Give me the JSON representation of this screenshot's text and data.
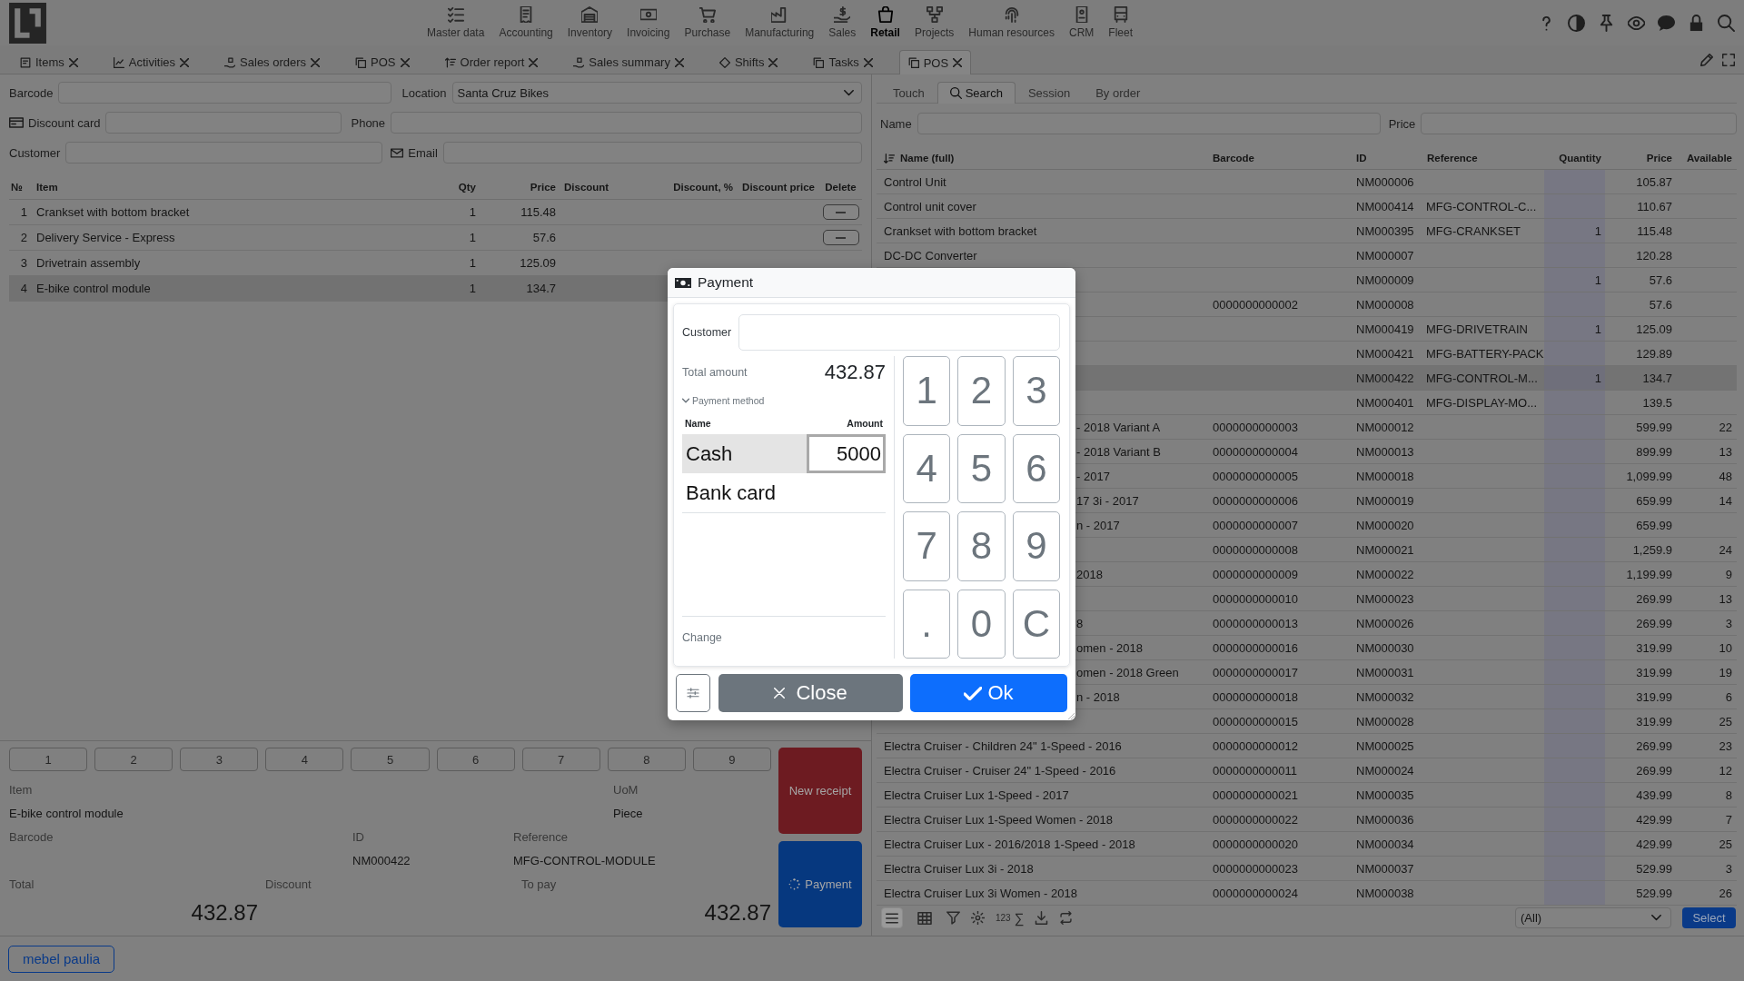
{
  "top_bar": {
    "modules": [
      {
        "label": "Master data",
        "selected": false
      },
      {
        "label": "Accounting",
        "selected": false
      },
      {
        "label": "Inventory",
        "selected": false
      },
      {
        "label": "Invoicing",
        "selected": false
      },
      {
        "label": "Purchase",
        "selected": false
      },
      {
        "label": "Manufacturing",
        "selected": false
      },
      {
        "label": "Sales",
        "selected": false
      },
      {
        "label": "Retail",
        "selected": true
      },
      {
        "label": "Projects",
        "selected": false
      },
      {
        "label": "Human resources",
        "selected": false
      },
      {
        "label": "CRM",
        "selected": false
      },
      {
        "label": "Fleet",
        "selected": false
      }
    ]
  },
  "tabs": [
    {
      "label": "Items",
      "selected": false
    },
    {
      "label": "Activities",
      "selected": false
    },
    {
      "label": "Sales orders",
      "selected": false
    },
    {
      "label": "POS",
      "selected": false
    },
    {
      "label": "Order report",
      "selected": false
    },
    {
      "label": "Sales summary",
      "selected": false
    },
    {
      "label": "Shifts",
      "selected": false
    },
    {
      "label": "Tasks",
      "selected": false
    },
    {
      "label": "POS",
      "selected": true
    }
  ],
  "pos": {
    "barcode_label": "Barcode",
    "location_label": "Location",
    "location": "Santa Cruz Bikes",
    "discount_card_label": "Discount card",
    "phone_label": "Phone",
    "customer_label": "Customer",
    "email_label": "Email",
    "receipt": {
      "columns": [
        "№",
        "Item",
        "Qty",
        "Price",
        "Discount",
        "Discount, %",
        "Discount price",
        "Delete"
      ],
      "rows": [
        {
          "n": "1",
          "item": "Crankset with bottom bracket",
          "qty": "1",
          "price": "115.48",
          "delete_button": true,
          "selected": false
        },
        {
          "n": "2",
          "item": "Delivery Service - Express",
          "qty": "1",
          "price": "57.6",
          "delete_button": true,
          "selected": false
        },
        {
          "n": "3",
          "item": "Drivetrain assembly",
          "qty": "1",
          "price": "125.09",
          "delete_button": false,
          "selected": false
        },
        {
          "n": "4",
          "item": "E-bike control module",
          "qty": "1",
          "price": "134.7",
          "delete_button": false,
          "selected": true
        }
      ]
    },
    "quick_keys": [
      "1",
      "2",
      "3",
      "4",
      "5",
      "6",
      "7",
      "8",
      "9"
    ],
    "details": {
      "item_label": "Item",
      "item": "E-bike control module",
      "uom_label": "UoM",
      "uom": "Piece",
      "barcode_label": "Barcode",
      "id_label": "ID",
      "id": "NM000422",
      "reference_label": "Reference",
      "reference": "MFG-CONTROL-MODULE",
      "total_label": "Total",
      "total": "432.87",
      "discount_label": "Discount",
      "to_pay_label": "To pay",
      "to_pay": "432.87"
    },
    "new_receipt": "New receipt",
    "payment": "Payment"
  },
  "catalog": {
    "tabs": [
      {
        "label": "Touch",
        "selected": false
      },
      {
        "label": "Search",
        "selected": true
      },
      {
        "label": "Session",
        "selected": false
      },
      {
        "label": "By order",
        "selected": false
      }
    ],
    "name_label": "Name",
    "price_label": "Price",
    "columns": [
      "Name (full)",
      "Barcode",
      "ID",
      "Reference",
      "Quantity",
      "Price",
      "Available"
    ],
    "rows": [
      {
        "name": "Control Unit",
        "kind": "open",
        "id": "NM000006",
        "price": "105.87",
        "selected": false
      },
      {
        "name": "Control unit cover",
        "kind": "open",
        "id": "NM000414",
        "reference": "MFG-CONTROL-C...",
        "price": "110.67",
        "selected": false
      },
      {
        "name": "Crankset with bottom bracket",
        "kind": "open",
        "id": "NM000395",
        "reference": "MFG-CRANKSET",
        "quantity": "1",
        "price": "115.48",
        "selected": false
      },
      {
        "name": "DC-DC Converter",
        "kind": "open",
        "id": "NM000007",
        "price": "120.28",
        "selected": false
      },
      {
        "id": "NM000009",
        "quantity": "1",
        "price": "57.6",
        "selected": false
      },
      {
        "barcode": "0000000000002",
        "id": "NM000008",
        "price": "57.6",
        "selected": false
      },
      {
        "id": "NM000419",
        "reference": "MFG-DRIVETRAIN",
        "quantity": "1",
        "price": "125.09",
        "selected": false
      },
      {
        "id": "NM000421",
        "reference": "MFG-BATTERY-PACK",
        "price": "129.89",
        "selected": false
      },
      {
        "id": "NM000422",
        "reference": "MFG-CONTROL-M...",
        "quantity": "1",
        "price": "134.7",
        "selected": true
      },
      {
        "id": "NM000401",
        "reference": "MFG-DISPLAY-MO...",
        "price": "139.5",
        "selected": false
      },
      {
        "name": "- 2018 Variant A",
        "kind": "covered",
        "barcode": "0000000000003",
        "id": "NM000012",
        "price": "599.99",
        "available": "22",
        "selected": false
      },
      {
        "name": "- 2018 Variant B",
        "kind": "covered",
        "barcode": "0000000000004",
        "id": "NM000013",
        "price": "899.99",
        "available": "13",
        "selected": false
      },
      {
        "name": "- 2017",
        "kind": "covered",
        "barcode": "0000000000005",
        "id": "NM000018",
        "price": "1,099.99",
        "available": "48",
        "selected": false
      },
      {
        "name": "17 3i - 2017",
        "kind": "covered",
        "barcode": "0000000000006",
        "id": "NM000019",
        "price": "659.99",
        "available": "14",
        "selected": false
      },
      {
        "name": "n - 2017",
        "kind": "covered",
        "barcode": "0000000000007",
        "id": "NM000020",
        "price": "659.99",
        "selected": false
      },
      {
        "barcode": "0000000000008",
        "id": "NM000021",
        "price": "1,259.9",
        "available": "24",
        "selected": false
      },
      {
        "name": "2018",
        "kind": "covered",
        "barcode": "0000000000009",
        "id": "NM000022",
        "price": "1,199.99",
        "available": "9",
        "selected": false
      },
      {
        "barcode": "0000000000010",
        "id": "NM000023",
        "price": "269.99",
        "available": "13",
        "selected": false
      },
      {
        "name": "8",
        "kind": "covered",
        "barcode": "0000000000013",
        "id": "NM000026",
        "price": "269.99",
        "available": "3",
        "selected": false
      },
      {
        "name": "omen - 2018",
        "kind": "covered",
        "barcode": "0000000000016",
        "id": "NM000030",
        "price": "319.99",
        "available": "10",
        "selected": false
      },
      {
        "name": "omen - 2018 Green",
        "kind": "covered",
        "barcode": "0000000000017",
        "id": "NM000031",
        "price": "319.99",
        "available": "19",
        "selected": false
      },
      {
        "name": "n - 2018",
        "kind": "covered",
        "barcode": "0000000000018",
        "id": "NM000032",
        "price": "319.99",
        "available": "6",
        "selected": false
      },
      {
        "barcode": "0000000000015",
        "id": "NM000028",
        "price": "319.99",
        "available": "25",
        "selected": false
      },
      {
        "name": "Electra Cruiser - Children 24\" 1-Speed - 2016",
        "kind": "open",
        "barcode": "0000000000012",
        "id": "NM000025",
        "price": "269.99",
        "available": "23",
        "selected": false
      },
      {
        "name": "Electra Cruiser - Cruiser 24\" 1-Speed - 2016",
        "kind": "open",
        "barcode": "0000000000011",
        "id": "NM000024",
        "price": "269.99",
        "available": "12",
        "selected": false
      },
      {
        "name": "Electra Cruiser Lux 1-Speed - 2017",
        "kind": "open",
        "barcode": "0000000000021",
        "id": "NM000035",
        "price": "439.99",
        "available": "8",
        "selected": false
      },
      {
        "name": "Electra Cruiser Lux 1-Speed Women - 2018",
        "kind": "open",
        "barcode": "0000000000022",
        "id": "NM000036",
        "price": "429.99",
        "available": "7",
        "selected": false
      },
      {
        "name": "Electra Cruiser Lux - 2016/2018 1-Speed - 2018",
        "kind": "open",
        "barcode": "0000000000020",
        "id": "NM000034",
        "price": "429.99",
        "available": "25",
        "selected": false
      },
      {
        "name": "Electra Cruiser Lux 3i - 2018",
        "kind": "open",
        "barcode": "0000000000023",
        "id": "NM000037",
        "price": "529.99",
        "available": "3",
        "selected": false
      },
      {
        "name": "Electra Cruiser Lux 3i Women - 2018",
        "kind": "open",
        "barcode": "0000000000024",
        "id": "NM000038",
        "price": "529.99",
        "available": "26",
        "selected": false
      }
    ],
    "views": [
      {
        "kind": "list",
        "selected": true
      },
      {
        "kind": "grid",
        "selected": false
      }
    ],
    "number_format": "123",
    "totals": "∑",
    "filter_value": "(All)",
    "select": "Select"
  },
  "payment_dialog": {
    "title": "Payment",
    "customer_label": "Customer",
    "total_label": "Total amount",
    "total": "432.87",
    "method_label": "Payment method",
    "method_expanded": true,
    "columns": [
      "Name",
      "Amount"
    ],
    "methods": [
      {
        "name": "Cash",
        "amount": "5000",
        "selected": true
      },
      {
        "name": "Bank card",
        "selected": false
      }
    ],
    "change_label": "Change",
    "keypad": [
      "1",
      "2",
      "3",
      "4",
      "5",
      "6",
      "7",
      "8",
      "9",
      ".",
      "0",
      "C"
    ],
    "close": "Close",
    "ok": "Ok"
  },
  "footer": {
    "user": "mebel paulia"
  }
}
